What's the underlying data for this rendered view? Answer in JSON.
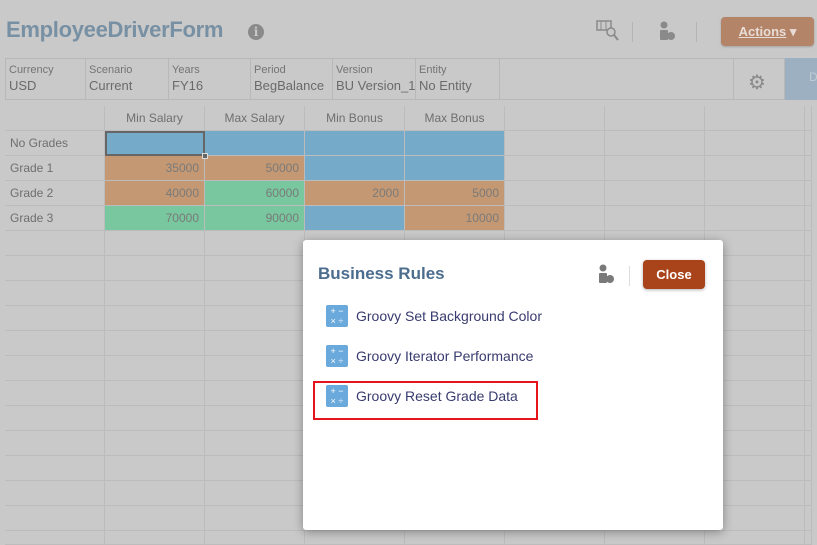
{
  "header": {
    "title": "EmployeeDriverForm",
    "info_icon": "i",
    "actions_label": "Actions"
  },
  "pov": [
    {
      "label": "Currency",
      "value": "USD"
    },
    {
      "label": "Scenario",
      "value": "Current"
    },
    {
      "label": "Years",
      "value": "FY16"
    },
    {
      "label": "Period",
      "value": "BegBalance"
    },
    {
      "label": "Version",
      "value": "BU Version_1"
    },
    {
      "label": "Entity",
      "value": "No Entity"
    }
  ],
  "pov_button_label": "D",
  "grid": {
    "columns": [
      "Min Salary",
      "Max Salary",
      "Min Bonus",
      "Max Bonus"
    ],
    "rows": [
      {
        "label": "No Grades",
        "cells": [
          "",
          "",
          "",
          ""
        ]
      },
      {
        "label": "Grade 1",
        "cells": [
          "35000",
          "50000",
          "",
          ""
        ]
      },
      {
        "label": "Grade 2",
        "cells": [
          "40000",
          "60000",
          "2000",
          "5000"
        ]
      },
      {
        "label": "Grade 3",
        "cells": [
          "70000",
          "90000",
          "",
          "10000"
        ]
      }
    ]
  },
  "colors": {
    "blue": "#75abc9",
    "orange": "#c49872",
    "green": "#78c79e",
    "close": "#a8431a",
    "highlight": "#e8141b"
  },
  "dialog": {
    "title": "Business Rules",
    "close_label": "Close",
    "rules": [
      "Groovy Set Background Color",
      "Groovy Iterator Performance",
      "Groovy Reset Grade Data"
    ]
  }
}
